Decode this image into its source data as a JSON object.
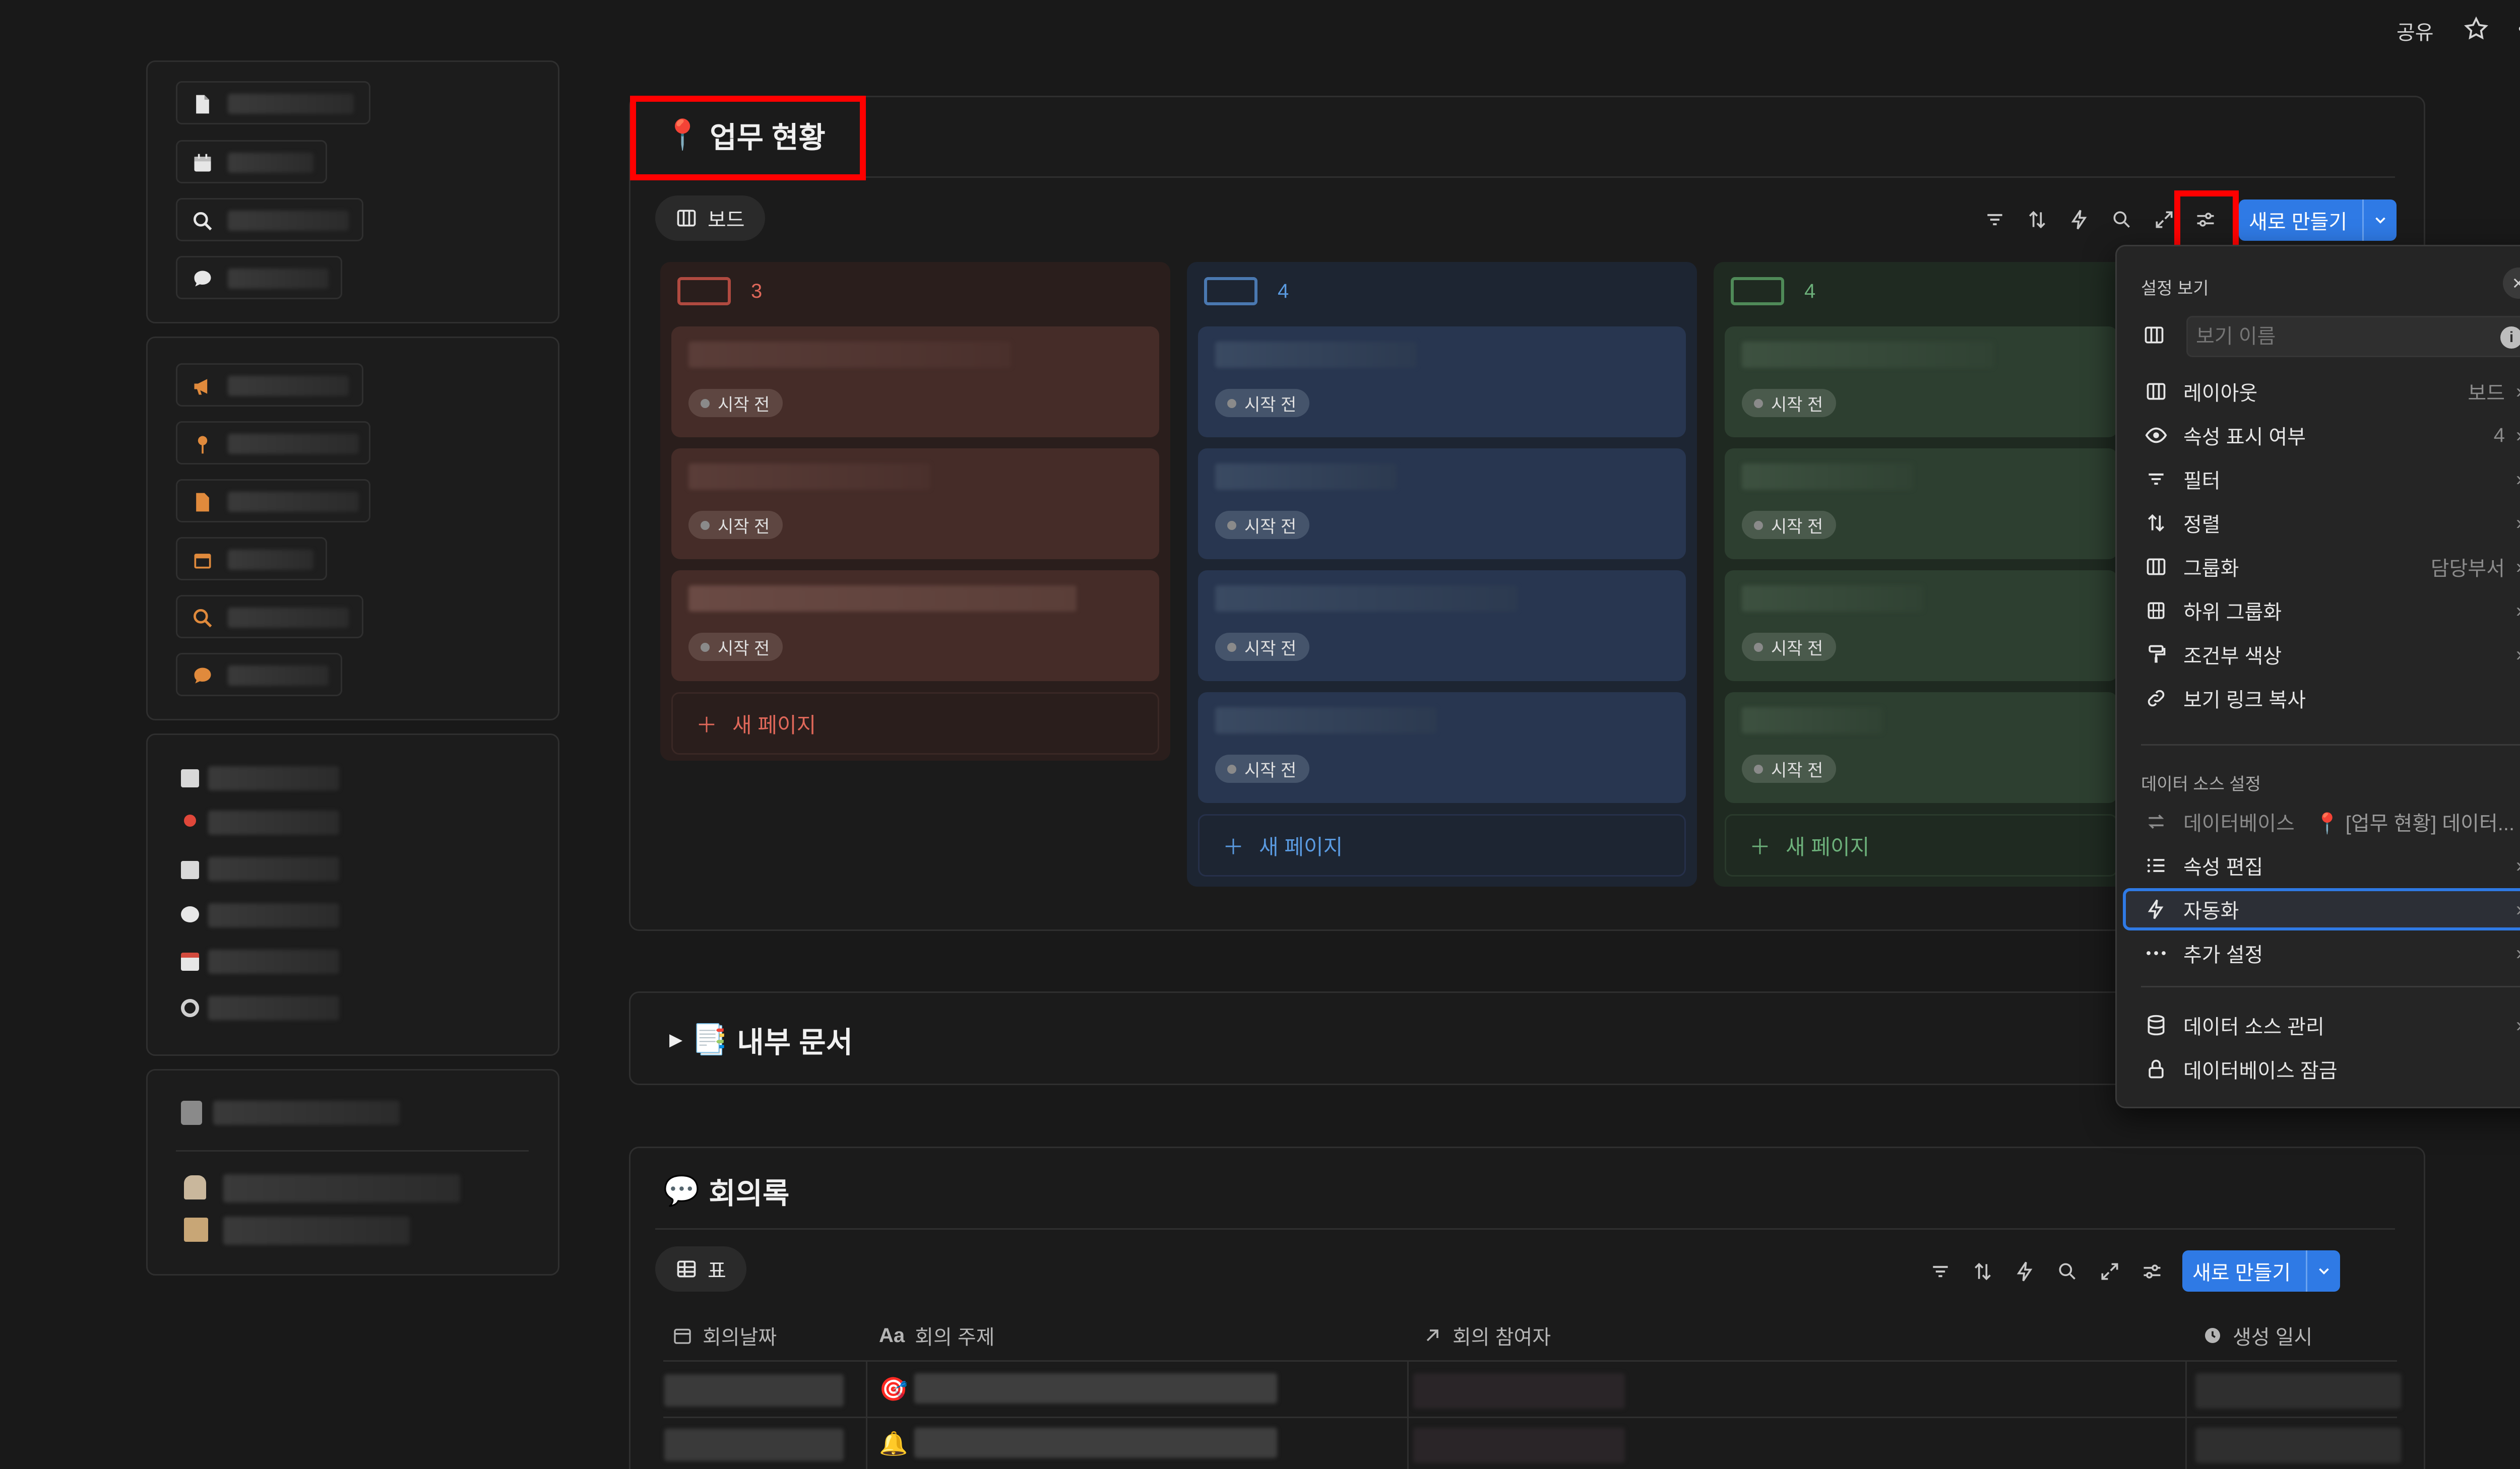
{
  "topbar": {
    "share_label": "공유"
  },
  "board_section": {
    "title_icon": "📍",
    "title": "업무 현황",
    "view_tab": "보드",
    "new_button": "새로 만들기",
    "columns": [
      {
        "count": "3",
        "new_page": "새 페이지",
        "cards": [
          "시작 전",
          "시작 전",
          "시작 전"
        ]
      },
      {
        "count": "4",
        "new_page": "새 페이지",
        "cards": [
          "시작 전",
          "시작 전",
          "시작 전",
          "시작 전"
        ]
      },
      {
        "count": "4",
        "new_page": "새 페이지",
        "cards": [
          "시작 전",
          "시작 전",
          "시작 전",
          "시작 전"
        ]
      }
    ]
  },
  "docs_section": {
    "toggle": "▶",
    "icon": "📑",
    "title": "내부 문서"
  },
  "meetings_section": {
    "icon": "💬",
    "title": "회의록",
    "view_tab": "표",
    "new_button": "새로 만들기",
    "columns": [
      "회의날짜",
      "회의 주제",
      "회의 참여자",
      "생성 일시"
    ],
    "column_prefix": "Aa",
    "rows": [
      {
        "icon": "🎯"
      },
      {
        "icon": "🔔"
      }
    ]
  },
  "popup": {
    "header": "설정 보기",
    "view_name_placeholder": "보기 이름",
    "items": [
      {
        "label": "레이아웃",
        "value": "보드"
      },
      {
        "label": "속성 표시 여부",
        "value": "4"
      },
      {
        "label": "필터",
        "value": ""
      },
      {
        "label": "정렬",
        "value": ""
      },
      {
        "label": "그룹화",
        "value": "담당부서"
      },
      {
        "label": "하위 그룹화",
        "value": ""
      },
      {
        "label": "조건부 색상",
        "value": ""
      },
      {
        "label": "보기 링크 복사",
        "value": ""
      }
    ],
    "data_source_label": "데이터 소스 설정",
    "data_source_db": "데이터베이스",
    "data_source_db_value": "📍 [업무 현황] 데이터...",
    "items2": [
      {
        "label": "속성 편집"
      },
      {
        "label": "자동화"
      },
      {
        "label": "추가 설정"
      }
    ],
    "items3": [
      {
        "label": "데이터 소스 관리"
      },
      {
        "label": "데이터베이스 잠금"
      }
    ]
  },
  "colors": {
    "accent": "#2f7ae5",
    "highlight": "#ff0000",
    "red_col": "#2c1f1d",
    "blue_col": "#1d2532",
    "green_col": "#1f2a21"
  }
}
